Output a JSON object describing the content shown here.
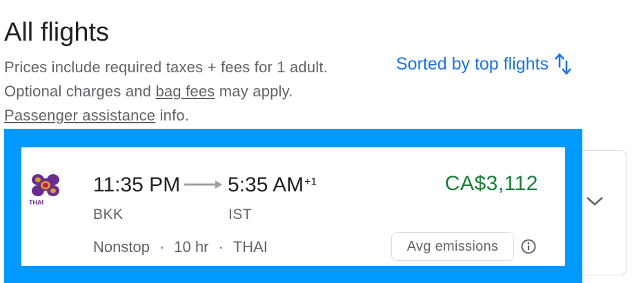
{
  "header": {
    "title": "All flights",
    "line1": "Prices include required taxes + fees for 1 adult.",
    "line2_prefix": "Optional charges and ",
    "line2_link": "bag fees",
    "line2_suffix": " may apply.",
    "line3_link": "Passenger assistance",
    "line3_suffix": " info.",
    "sort_label": "Sorted by top flights"
  },
  "flight": {
    "airline_logo_text": "THAI",
    "departure_time": "11:35 PM",
    "arrival_time": "5:35 AM",
    "arrival_day_offset": "+1",
    "departure_airport": "BKK",
    "arrival_airport": "IST",
    "stops": "Nonstop",
    "duration": "10 hr",
    "airline": "THAI",
    "separator": "·",
    "price": "CA$3,112",
    "emissions_label": "Avg emissions"
  },
  "colors": {
    "accent": "#1a73e8",
    "price": "#188038",
    "highlight": "#0099ff"
  }
}
